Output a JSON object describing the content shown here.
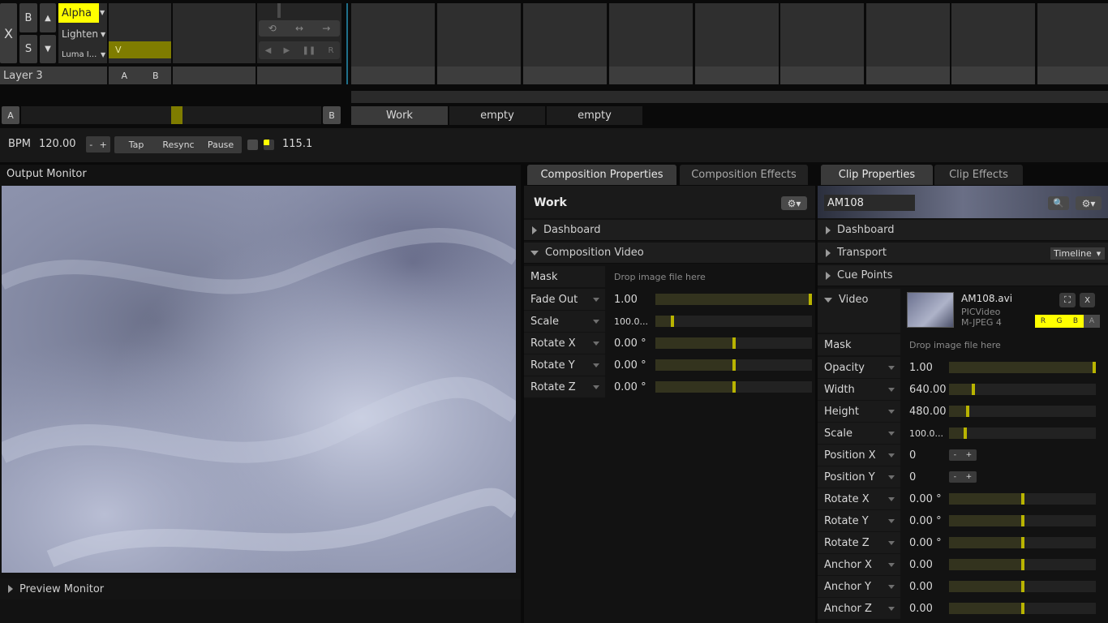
{
  "layer": {
    "close_label": "X",
    "bypass_label": "B",
    "solo_label": "S",
    "blend_modes": [
      "Alpha",
      "Lighten",
      "Luma I..."
    ],
    "video_label": "V",
    "name": "Layer 3",
    "a_label": "A",
    "b_label": "B",
    "transport_r_label": "R"
  },
  "crossfader": {
    "a_label": "A",
    "b_label": "B",
    "position": 0.52
  },
  "deck_tabs": [
    "Work",
    "empty",
    "empty"
  ],
  "tempo": {
    "bpm_label": "BPM",
    "bpm_value": "120.00",
    "minus_label": "-",
    "plus_label": "+",
    "tap_label": "Tap",
    "resync_label": "Resync",
    "pause_label": "Pause",
    "fps_value": "115.1"
  },
  "output_monitor": {
    "title": "Output Monitor",
    "preview_label": "Preview Monitor"
  },
  "composition": {
    "tabs": [
      "Composition Properties",
      "Composition Effects"
    ],
    "name": "Work",
    "sections": [
      "Dashboard",
      "Composition Video"
    ],
    "mask_label": "Mask",
    "mask_drop": "Drop image file here",
    "params": [
      {
        "label": "Fade Out",
        "value": "1.00",
        "level": 1.0
      },
      {
        "label": "Scale",
        "value": "100.0...",
        "level": 0.1
      },
      {
        "label": "Rotate X",
        "value": "0.00 °",
        "level": 0.5
      },
      {
        "label": "Rotate Y",
        "value": "0.00 °",
        "level": 0.5
      },
      {
        "label": "Rotate Z",
        "value": "0.00 °",
        "level": 0.5
      }
    ]
  },
  "clip": {
    "tabs": [
      "Clip Properties",
      "Clip Effects"
    ],
    "name": "AM108",
    "sections": [
      "Dashboard",
      "Transport",
      "Cue Points"
    ],
    "transport_mode": "Timeline",
    "video_label": "Video",
    "file_name": "AM108.avi",
    "codec_line1": "PICVideo",
    "codec_line2": "M-JPEG 4",
    "rgba": [
      "R",
      "G",
      "B",
      "A"
    ],
    "clip_x_label": "X",
    "mask_label": "Mask",
    "mask_drop": "Drop image file here",
    "params": [
      {
        "label": "Opacity",
        "value": "1.00",
        "kind": "slider",
        "level": 1.0
      },
      {
        "label": "Width",
        "value": "640.00",
        "kind": "slider",
        "level": 0.16
      },
      {
        "label": "Height",
        "value": "480.00",
        "kind": "slider",
        "level": 0.12
      },
      {
        "label": "Scale",
        "value": "100.0...",
        "kind": "slider",
        "level": 0.1
      },
      {
        "label": "Position X",
        "value": "0",
        "kind": "stepper"
      },
      {
        "label": "Position Y",
        "value": "0",
        "kind": "stepper"
      },
      {
        "label": "Rotate X",
        "value": "0.00 °",
        "kind": "slider",
        "level": 0.5
      },
      {
        "label": "Rotate Y",
        "value": "0.00 °",
        "kind": "slider",
        "level": 0.5
      },
      {
        "label": "Rotate Z",
        "value": "0.00 °",
        "kind": "slider",
        "level": 0.5
      },
      {
        "label": "Anchor X",
        "value": "0.00",
        "kind": "slider",
        "level": 0.5
      },
      {
        "label": "Anchor Y",
        "value": "0.00",
        "kind": "slider",
        "level": 0.5
      },
      {
        "label": "Anchor Z",
        "value": "0.00",
        "kind": "slider",
        "level": 0.5
      }
    ],
    "stepper_minus": "-",
    "stepper_plus": "+"
  },
  "colors": {
    "accent_yellow": "#ffff00",
    "knob_yellow": "#b9b400",
    "video_bar": "#7f7c00"
  },
  "icons": [
    "gear-icon",
    "search-icon",
    "fullscreen-icon",
    "loop-icon",
    "bounce-icon",
    "forward-icon",
    "play-back-icon",
    "play-fwd-icon",
    "pause-icon"
  ]
}
